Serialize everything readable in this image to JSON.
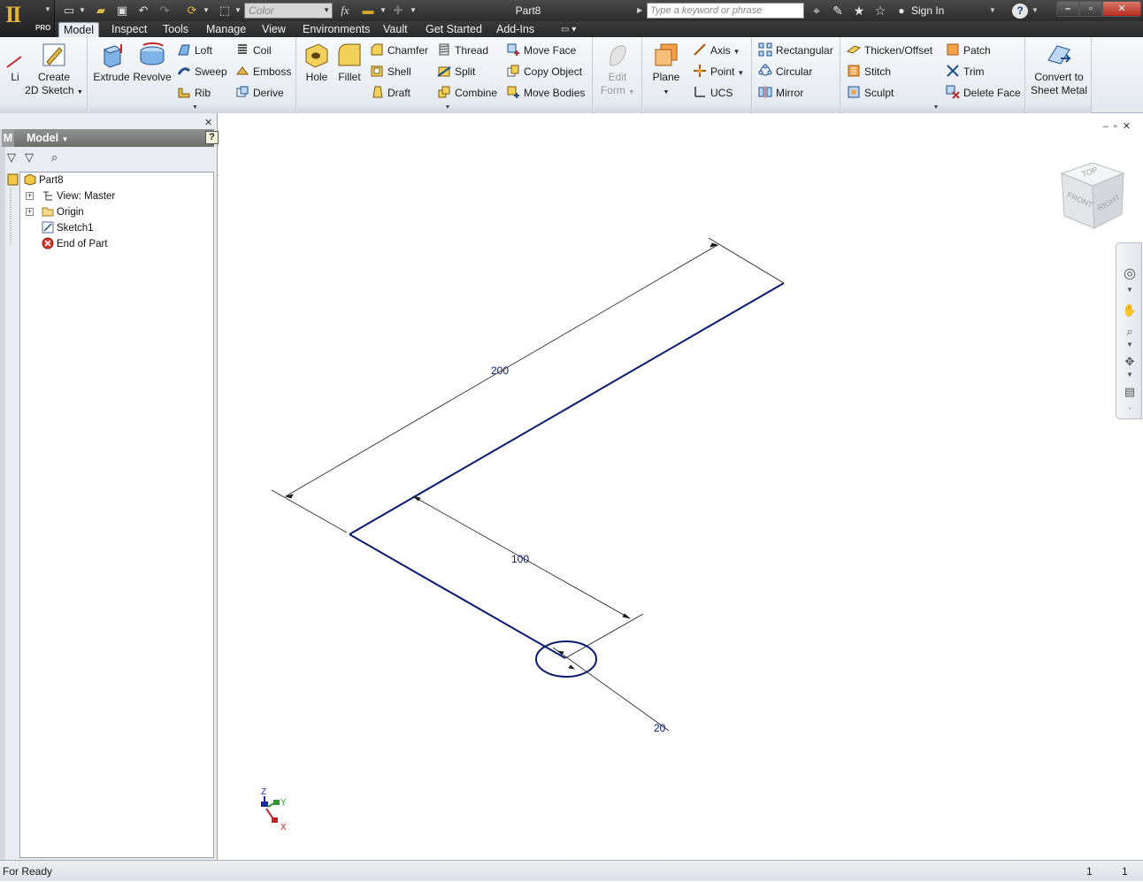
{
  "app": {
    "badge": "PRO",
    "document_title": "Part8"
  },
  "quick_access": {
    "color_placeholder": "Color"
  },
  "search": {
    "placeholder": "Type a keyword or phrase"
  },
  "account": {
    "sign_in": "Sign In",
    "help": "?"
  },
  "tabs": [
    {
      "label": "Model",
      "active": true
    },
    {
      "label": "Inspect"
    },
    {
      "label": "Tools"
    },
    {
      "label": "Manage"
    },
    {
      "label": "View"
    },
    {
      "label": "Environments"
    },
    {
      "label": "Vault"
    },
    {
      "label": "Get Started"
    },
    {
      "label": "Add-Ins"
    }
  ],
  "ribbon": {
    "sketch": {
      "line": "Li",
      "create_2d_sketch_1": "Create",
      "create_2d_sketch_2": "2D Sketch"
    },
    "create": {
      "extrude": "Extrude",
      "revolve": "Revolve",
      "loft": "Loft",
      "sweep": "Sweep",
      "rib": "Rib",
      "coil": "Coil",
      "emboss": "Emboss",
      "derive": "Derive"
    },
    "modify": {
      "hole": "Hole",
      "fillet": "Fillet",
      "chamfer": "Chamfer",
      "shell": "Shell",
      "draft": "Draft",
      "thread": "Thread",
      "split": "Split",
      "combine": "Combine",
      "move_face": "Move Face",
      "copy_object": "Copy Object",
      "move_bodies": "Move Bodies"
    },
    "freeform": {
      "edit_form_1": "Edit",
      "edit_form_2": "Form"
    },
    "work_features": {
      "plane": "Plane",
      "axis": "Axis",
      "point": "Point",
      "ucs": "UCS"
    },
    "pattern": {
      "rectangular": "Rectangular",
      "circular": "Circular",
      "mirror": "Mirror"
    },
    "surface": {
      "thicken_offset": "Thicken/Offset",
      "stitch": "Stitch",
      "sculpt": "Sculpt",
      "patch": "Patch",
      "trim": "Trim",
      "delete_face": "Delete Face"
    },
    "convert": {
      "convert_1": "Convert to",
      "convert_2": "Sheet Metal"
    }
  },
  "browser": {
    "side_letter": "M",
    "title": "Model",
    "help": "?",
    "tree": [
      {
        "label": "Part8"
      },
      {
        "label": "View: Master"
      },
      {
        "label": "Origin"
      },
      {
        "label": "Sketch1"
      },
      {
        "label": "End of Part"
      }
    ]
  },
  "viewcube": {
    "top": "TOP",
    "front": "FRONT",
    "right": "RIGHT"
  },
  "sketch": {
    "dim_200": "200",
    "dim_100": "100",
    "dim_20": "20",
    "line_color": "#0a1a6e"
  },
  "triad": {
    "x": "X",
    "y": "Y",
    "z": "Z"
  },
  "status": {
    "text": "For Ready",
    "n1": "1",
    "n2": "1"
  }
}
